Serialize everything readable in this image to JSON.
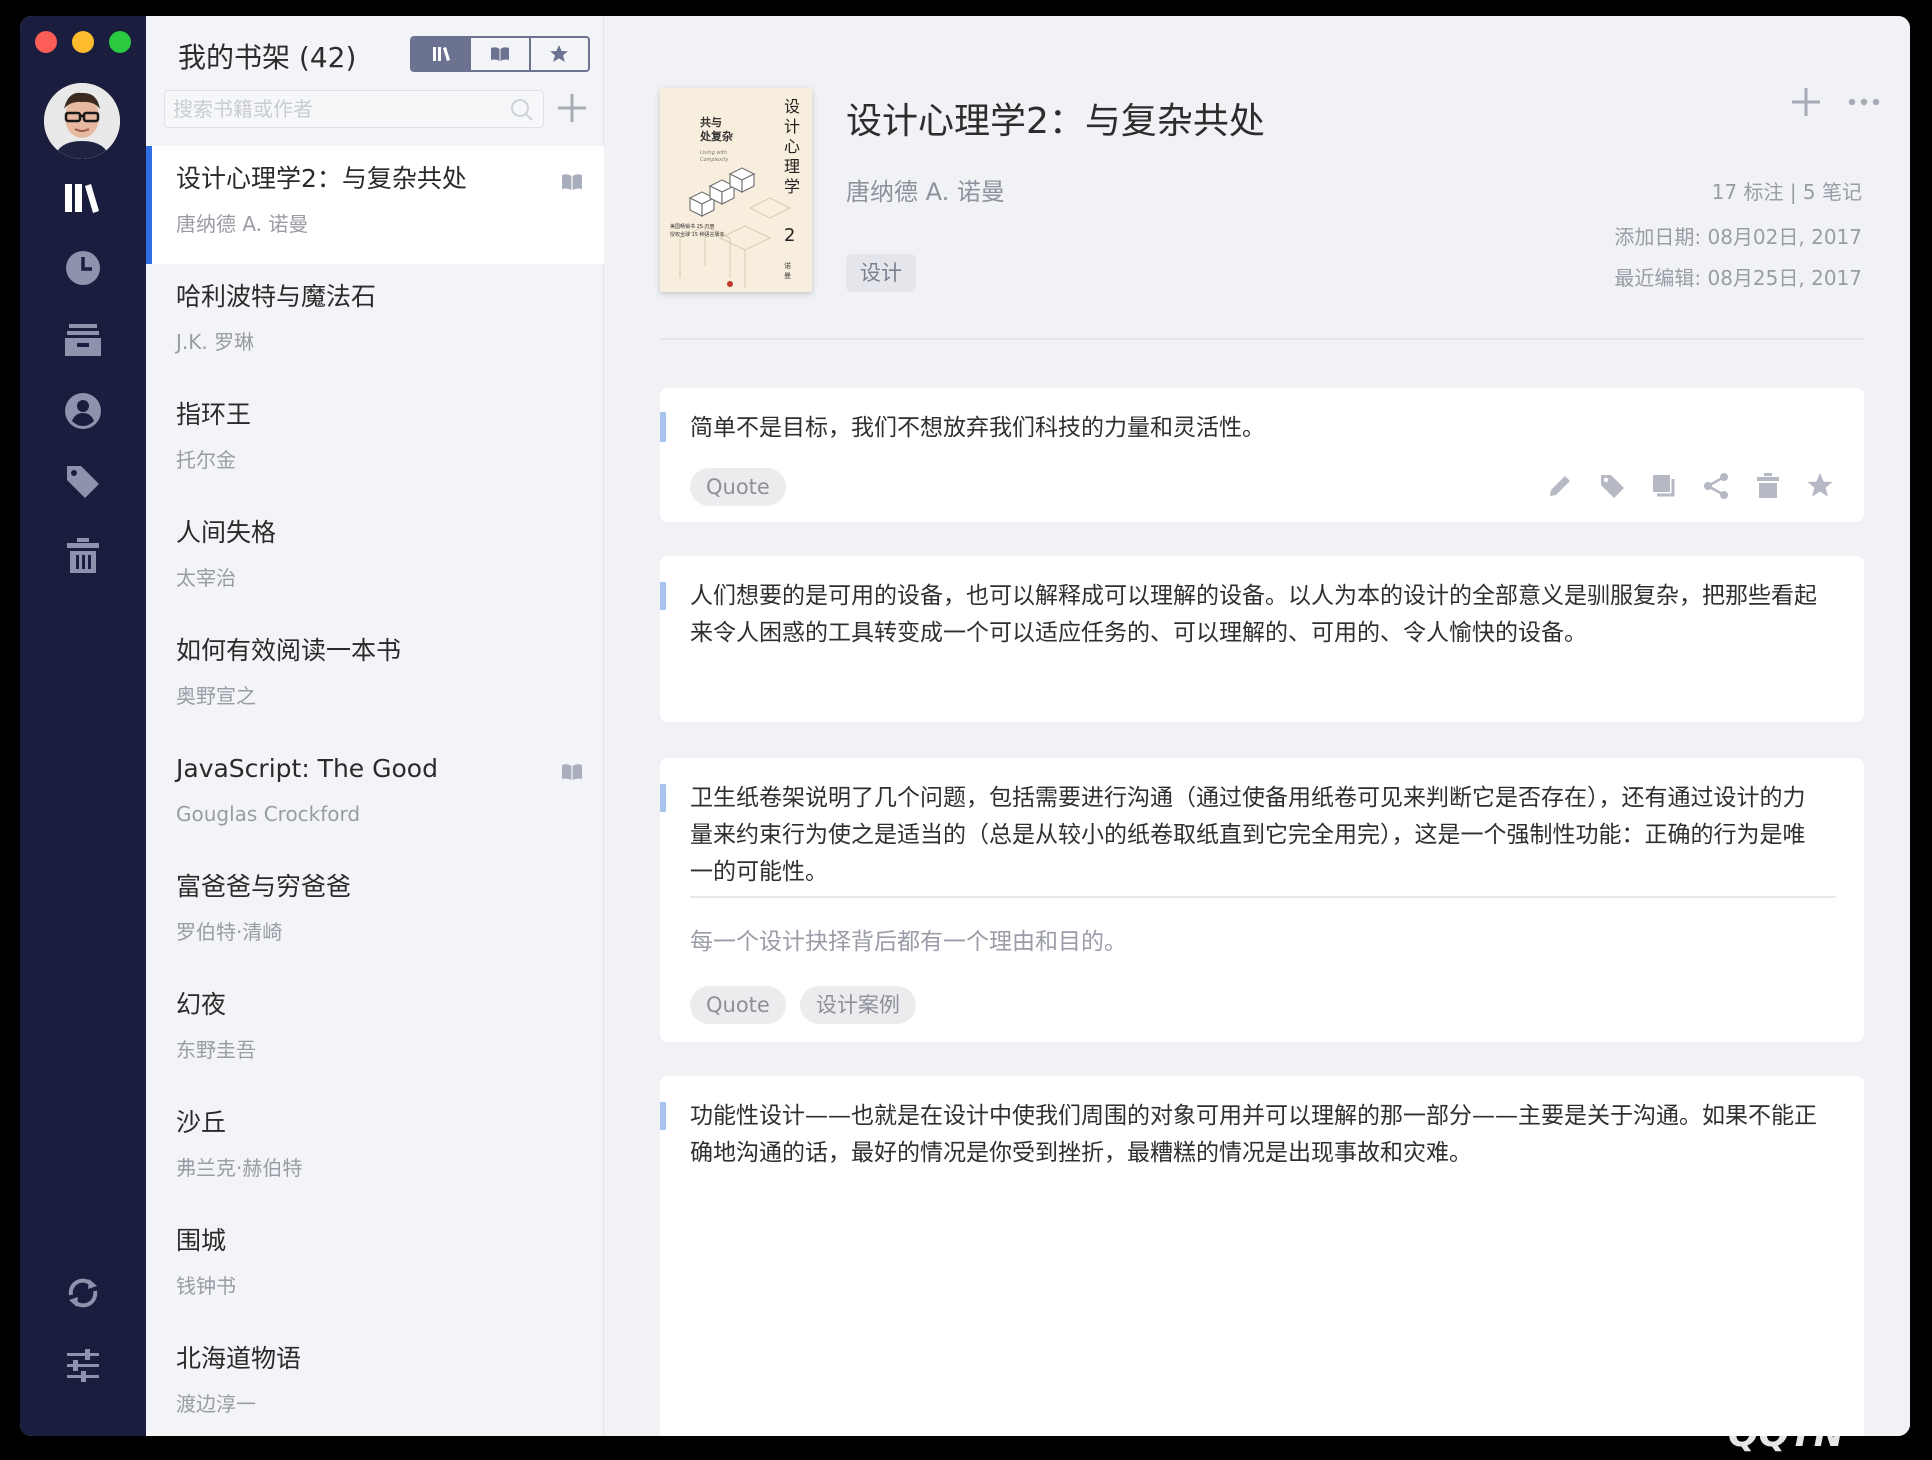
{
  "sidebar": {
    "items": [
      {
        "name": "library",
        "icon": "library-icon",
        "active": true
      },
      {
        "name": "recent",
        "icon": "clock-icon",
        "active": false
      },
      {
        "name": "archive",
        "icon": "archive-box-icon",
        "active": false
      },
      {
        "name": "profile",
        "icon": "user-icon",
        "active": false
      },
      {
        "name": "tags",
        "icon": "tag-icon",
        "active": false
      },
      {
        "name": "trash",
        "icon": "trash-icon",
        "active": false
      }
    ],
    "bottom": [
      {
        "name": "sync",
        "icon": "sync-icon"
      },
      {
        "name": "settings",
        "icon": "sliders-icon"
      }
    ]
  },
  "list": {
    "title": "我的书架 (42)",
    "search_placeholder": "搜索书籍或作者",
    "books": [
      {
        "title": "设计心理学2：与复杂共处",
        "author": "唐纳德 A. 诺曼",
        "active": true,
        "reading": true
      },
      {
        "title": "哈利波特与魔法石",
        "author": "J.K. 罗琳",
        "active": false,
        "reading": false
      },
      {
        "title": "指环王",
        "author": "托尔金",
        "active": false,
        "reading": false
      },
      {
        "title": "人间失格",
        "author": "太宰治",
        "active": false,
        "reading": false
      },
      {
        "title": "如何有效阅读一本书",
        "author": "奥野宣之",
        "active": false,
        "reading": false
      },
      {
        "title": "JavaScript: The Good",
        "author": "Gouglas Crockford",
        "active": false,
        "reading": true
      },
      {
        "title": "富爸爸与穷爸爸",
        "author": "罗伯特·清崎",
        "active": false,
        "reading": false
      },
      {
        "title": "幻夜",
        "author": "东野圭吾",
        "active": false,
        "reading": false
      },
      {
        "title": "沙丘",
        "author": "弗兰克·赫伯特",
        "active": false,
        "reading": false
      },
      {
        "title": "围城",
        "author": "钱钟书",
        "active": false,
        "reading": false
      },
      {
        "title": "北海道物语",
        "author": "渡边淳一",
        "active": false,
        "reading": false
      }
    ]
  },
  "detail": {
    "title": "设计心理学2：与复杂共处",
    "author": "唐纳德 A. 诺曼",
    "tag": "设计",
    "counts": "17 标注 | 5 笔记",
    "added": "添加日期: 08月02日, 2017",
    "edited": "最近编辑: 08月25日, 2017",
    "cover": {
      "title_v": "设计心理学",
      "number": "2",
      "subtitle": "与复杂共处",
      "author_v": "诺曼"
    }
  },
  "cards": [
    {
      "text": "简单不是目标，我们不想放弃我们科技的力量和灵活性。",
      "chips": [
        "Quote"
      ],
      "note": null
    },
    {
      "text": "人们想要的是可用的设备，也可以解释成可以理解的设备。以人为本的设计的全部意义是驯服复杂，把那些看起来令人困惑的工具转变成一个可以适应任务的、可以理解的、可用的、令人愉快的设备。",
      "chips": [],
      "note": null
    },
    {
      "text": "卫生纸卷架说明了几个问题，包括需要进行沟通（通过使备用纸卷可见来判断它是否存在），还有通过设计的力量来约束行为使之是适当的（总是从较小的纸卷取纸直到它完全用完），这是一个强制性功能：正确的行为是唯一的可能性。",
      "chips": [
        "Quote",
        "设计案例"
      ],
      "note": "每一个设计抉择背后都有一个理由和目的。"
    },
    {
      "text": "功能性设计——也就是在设计中使我们周围的对象可用并可以理解的那一部分——主要是关于沟通。如果不能正确地沟通的话，最好的情况是你受到挫折，最糟糕的情况是出现事故和灾难。",
      "chips": [],
      "note": null
    }
  ],
  "colors": {
    "rail": "#1a1d3d",
    "accent": "#2f6de1",
    "quote_bar": "#a7c4ee"
  }
}
